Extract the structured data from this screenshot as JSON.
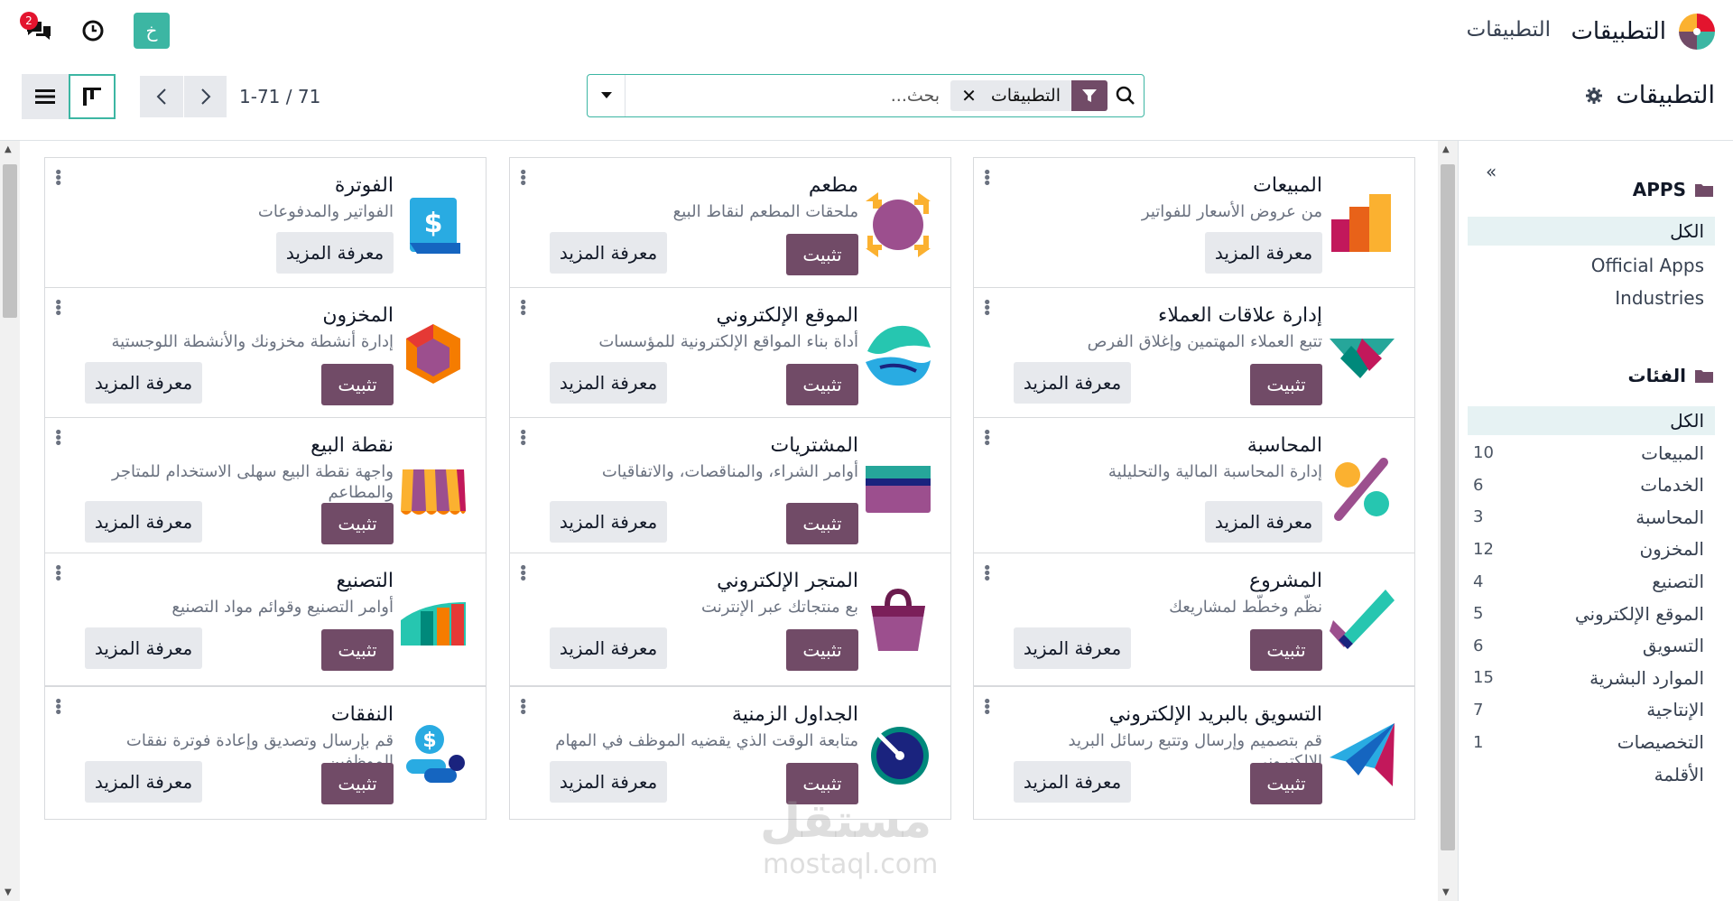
{
  "navbar": {
    "brand_title": "التطبيقات",
    "menu_link": "التطبيقات",
    "avatar_letter": "خ",
    "messages_badge": "2"
  },
  "control": {
    "breadcrumb": "التطبيقات",
    "facet_label": "التطبيقات",
    "search_placeholder": "بحث...",
    "pager_value": "1-71 / 71"
  },
  "sidebar": {
    "apps_title": "APPS",
    "apps_items": [
      {
        "label": "الكل"
      },
      {
        "label": "Official Apps"
      },
      {
        "label": "Industries"
      }
    ],
    "categories_title": "الفئات",
    "categories": [
      {
        "label": "الكل",
        "count": ""
      },
      {
        "label": "المبيعات",
        "count": "10"
      },
      {
        "label": "الخدمات",
        "count": "6"
      },
      {
        "label": "المحاسبة",
        "count": "3"
      },
      {
        "label": "المخزون",
        "count": "12"
      },
      {
        "label": "التصنيع",
        "count": "4"
      },
      {
        "label": "الموقع الإلكتروني",
        "count": "5"
      },
      {
        "label": "التسويق",
        "count": "6"
      },
      {
        "label": "الموارد البشرية",
        "count": "15"
      },
      {
        "label": "الإنتاجية",
        "count": "7"
      },
      {
        "label": "التخصيصات",
        "count": "1"
      },
      {
        "label": "الأقلمة",
        "count": ""
      }
    ]
  },
  "buttons": {
    "install": "تثبيت",
    "learn_more": "معرفة المزيد"
  },
  "apps": [
    {
      "title": "المبيعات",
      "desc": "من عروض الأسعار للفواتير",
      "icon": "sales-icon",
      "installed": true
    },
    {
      "title": "مطعم",
      "desc": "ملحقات المطعم لنقاط البيع",
      "icon": "restaurant-icon",
      "installed": false
    },
    {
      "title": "الفوترة",
      "desc": "الفواتير والمدفوعات",
      "icon": "invoicing-icon",
      "installed": true
    },
    {
      "title": "إدارة علاقات العملاء",
      "desc": "تتبع العملاء المهتمين وإغلاق الفرص",
      "icon": "crm-icon",
      "installed": false
    },
    {
      "title": "الموقع الإلكتروني",
      "desc": "أداة بناء المواقع الإلكترونية للمؤسسات",
      "icon": "website-icon",
      "installed": false
    },
    {
      "title": "المخزون",
      "desc": "إدارة أنشطة مخزونك والأنشطة اللوجستية",
      "icon": "inventory-icon",
      "installed": false
    },
    {
      "title": "المحاسبة",
      "desc": "إدارة المحاسبة المالية والتحليلية",
      "icon": "accounting-icon",
      "installed": true
    },
    {
      "title": "المشتريات",
      "desc": "أوامر الشراء، والمناقصات، والاتفاقيات",
      "icon": "purchase-icon",
      "installed": false
    },
    {
      "title": "نقطة البيع",
      "desc": "واجهة نقطة البيع سهلى الاستخدام للمتاجر والمطاعم",
      "icon": "pos-icon",
      "installed": false
    },
    {
      "title": "المشروع",
      "desc": "نظّم وخطّط لمشاريعك",
      "icon": "project-icon",
      "installed": false
    },
    {
      "title": "المتجر الإلكتروني",
      "desc": "بع منتجاتك عبر الإنترنت",
      "icon": "ecommerce-icon",
      "installed": false
    },
    {
      "title": "التصنيع",
      "desc": "أوامر التصنيع وقوائم مواد التصنيع",
      "icon": "manufacturing-icon",
      "installed": false
    },
    {
      "title": "التسويق بالبريد الإلكتروني",
      "desc": "قم بتصميم وإرسال وتتبع رسائل البريد الإلكتروني",
      "icon": "email-marketing-icon",
      "installed": false
    },
    {
      "title": "الجداول الزمنية",
      "desc": "متابعة الوقت الذي يقضيه الموظف في المهام",
      "icon": "timesheets-icon",
      "installed": false
    },
    {
      "title": "النفقات",
      "desc": "قم بإرسال وتصديق وإعادة فوترة نفقات الموظفين",
      "icon": "expenses-icon",
      "installed": false
    }
  ],
  "watermark": "مستقل",
  "watermark_url": "mostaql.com"
}
